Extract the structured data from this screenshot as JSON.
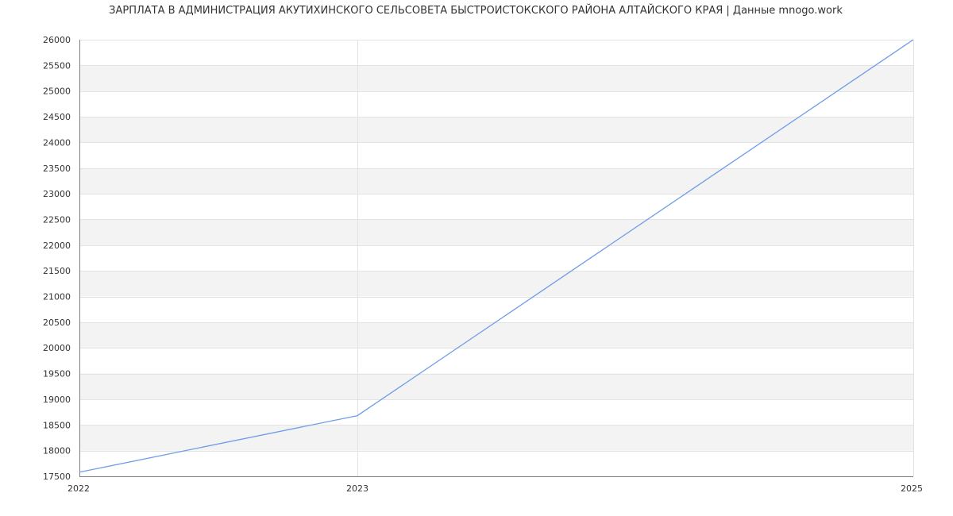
{
  "chart_data": {
    "type": "line",
    "title": "ЗАРПЛАТА В АДМИНИСТРАЦИЯ АКУТИХИНСКОГО СЕЛЬСОВЕТА БЫСТРОИСТОКСКОГО РАЙОНА АЛТАЙСКОГО КРАЯ | Данные mnogo.work",
    "xlabel": "",
    "ylabel": "",
    "x": [
      2022,
      2023,
      2025
    ],
    "series": [
      {
        "values": [
          17580,
          18680,
          26000
        ]
      }
    ],
    "xlim": [
      2022,
      2025
    ],
    "ylim": [
      17500,
      26000
    ],
    "x_ticks": [
      "2022",
      "2023",
      "2025"
    ],
    "y_ticks": [
      "17500",
      "18000",
      "18500",
      "19000",
      "19500",
      "20000",
      "20500",
      "21000",
      "21500",
      "22000",
      "22500",
      "23000",
      "23500",
      "24000",
      "24500",
      "25000",
      "25500",
      "26000"
    ],
    "grid": true,
    "band_color": "#f3f3f3",
    "grid_color": "#e3e3e3",
    "axis_color": "#7f7f7f",
    "line_color": "#6f9ce8"
  }
}
